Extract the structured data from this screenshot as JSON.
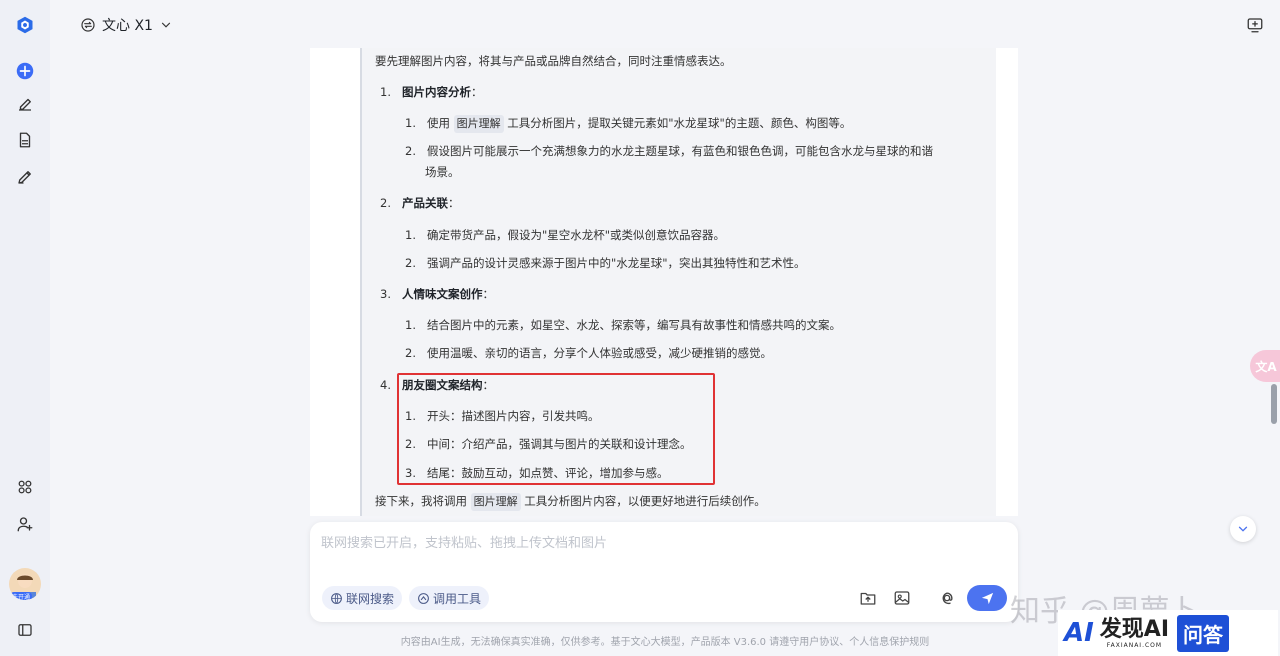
{
  "header": {
    "model_label": "文心 X1"
  },
  "thinking": {
    "intro": "要先理解图片内容，将其与产品或品牌自然结合，同时注重情感表达。",
    "sections": [
      {
        "num": "1.",
        "title": "图片内容分析",
        "colon": "：",
        "items": [
          {
            "num": "1.",
            "pre": "使用 ",
            "chip": "图片理解",
            "post": " 工具分析图片，提取关键元素如\"水龙星球\"的主题、颜色、构图等。"
          },
          {
            "num": "2.",
            "text": "假设图片可能展示一个充满想象力的水龙主题星球，有蓝色和银色色调，可能包含水龙与星球的和谐",
            "cont": "场景。"
          }
        ]
      },
      {
        "num": "2.",
        "title": "产品关联",
        "colon": "：",
        "items": [
          {
            "num": "1.",
            "text": "确定带货产品，假设为\"星空水龙杯\"或类似创意饮品容器。"
          },
          {
            "num": "2.",
            "text": "强调产品的设计灵感来源于图片中的\"水龙星球\"，突出其独特性和艺术性。"
          }
        ]
      },
      {
        "num": "3.",
        "title": "人情味文案创作",
        "colon": "：",
        "items": [
          {
            "num": "1.",
            "text": "结合图片中的元素，如星空、水龙、探索等，编写具有故事性和情感共鸣的文案。"
          },
          {
            "num": "2.",
            "text": "使用温暖、亲切的语言，分享个人体验或感受，减少硬推销的感觉。"
          }
        ]
      },
      {
        "num": "4.",
        "title": "朋友圈文案结构",
        "colon": "：",
        "items": [
          {
            "num": "1.",
            "text": "开头：描述图片内容，引发共鸣。"
          },
          {
            "num": "2.",
            "text": "中间：介绍产品，强调其与图片的关联和设计理念。"
          },
          {
            "num": "3.",
            "text": "结尾：鼓励互动，如点赞、评论，增加参与感。"
          }
        ]
      }
    ],
    "outro_pre": "接下来，我将调用 ",
    "outro_chip": "图片理解",
    "outro_post": " 工具分析图片内容，以便更好地进行后续创作。"
  },
  "input": {
    "placeholder": "联网搜索已开启，支持粘贴、拖拽上传文档和图片",
    "web_search_label": "联网搜索",
    "tools_label": "调用工具"
  },
  "footer": {
    "text": "内容由AI生成，无法确保真实准确，仅供参考。基于文心大模型，产品版本 V3.6.0 请遵守用户协议、个人信息保护规则"
  },
  "floating": {
    "translate_label": "文A"
  },
  "avatar": {
    "label": "未开通"
  },
  "watermark": {
    "zhihu": "知乎 @周萝卜",
    "brand": "发现AI",
    "brand_sub": "FAXIANAI.COM",
    "qa": "问答",
    "logo": "AI"
  },
  "colors": {
    "accent": "#4c73f0",
    "highlight_box": "#e03234",
    "sidebar_plus": "#3b6cf6"
  }
}
